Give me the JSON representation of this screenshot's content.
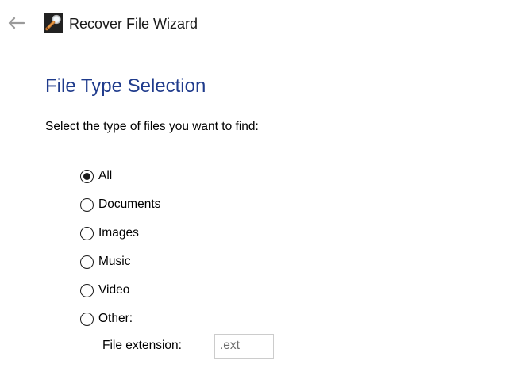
{
  "window": {
    "title": "Recover File Wizard"
  },
  "page": {
    "heading": "File Type Selection",
    "instructions": "Select the type of files you want to find:"
  },
  "file_types": [
    {
      "label": "All",
      "selected": true
    },
    {
      "label": "Documents",
      "selected": false
    },
    {
      "label": "Images",
      "selected": false
    },
    {
      "label": "Music",
      "selected": false
    },
    {
      "label": "Video",
      "selected": false
    },
    {
      "label": "Other:",
      "selected": false
    }
  ],
  "extension": {
    "label": "File extension:",
    "placeholder": ".ext",
    "value": ""
  },
  "colors": {
    "heading": "#1f3b8c",
    "back_arrow": "#9a9a9a"
  },
  "icons": {
    "back": "back-arrow-icon",
    "app": "magnifier-file-icon"
  }
}
